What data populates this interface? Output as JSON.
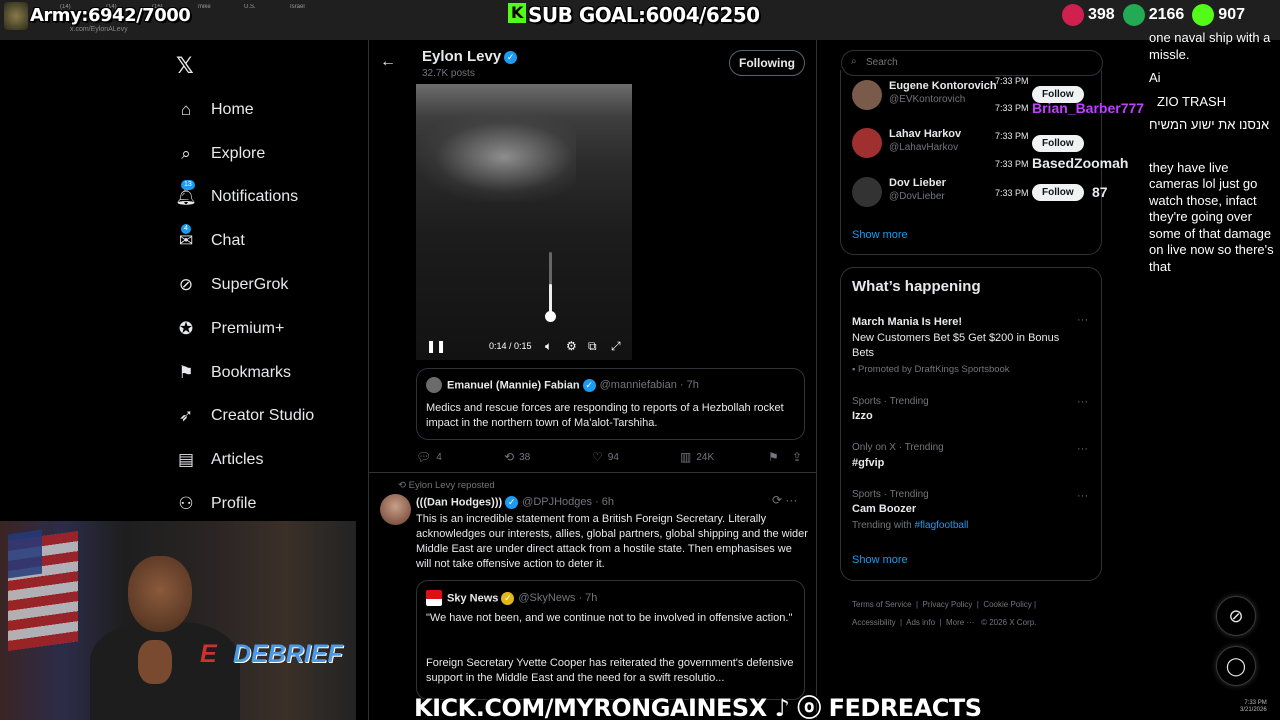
{
  "browser": {
    "tabs": [
      "(14)",
      "(14)",
      "(16)",
      "mike",
      "U.S.",
      "Israel",
      "Twitt",
      "Octo",
      "Design",
      "(17)",
      "18 U",
      "(17)"
    ],
    "url": "x.com/EylonALevy"
  },
  "overlays": {
    "army": "Army:6942/7000",
    "sub_goal": "SUB GOAL:6004/6250",
    "stats": [
      {
        "value": "398",
        "color": "#d02050",
        "icon": "gift-icon"
      },
      {
        "value": "2166",
        "color": "#22aa55",
        "icon": "kick-icon"
      },
      {
        "value": "907",
        "color": "#53fc18",
        "icon": "rumble-icon"
      }
    ],
    "bottom": "KICK.COM/MYRONGAINESX ♪ ⓞ FEDREACTS"
  },
  "nav": {
    "items": [
      {
        "label": "Home",
        "icon": "home-icon"
      },
      {
        "label": "Explore",
        "icon": "search-icon"
      },
      {
        "label": "Notifications",
        "icon": "bell-icon",
        "badge": "13"
      },
      {
        "label": "Chat",
        "icon": "mail-icon",
        "badge": "4"
      },
      {
        "label": "SuperGrok",
        "icon": "grok-icon"
      },
      {
        "label": "Premium+",
        "icon": "verified-icon"
      },
      {
        "label": "Bookmarks",
        "icon": "bookmark-icon"
      },
      {
        "label": "Creator Studio",
        "icon": "rocket-icon"
      },
      {
        "label": "Articles",
        "icon": "article-icon"
      },
      {
        "label": "Profile",
        "icon": "user-icon"
      }
    ]
  },
  "header": {
    "name": "Eylon Levy",
    "posts": "32.7K posts",
    "following": "Following"
  },
  "video": {
    "time": "0:14 / 0:15",
    "volume": 0.5
  },
  "quoted_post": {
    "name": "Emanuel (Mannie) Fabian",
    "handle": "@manniefabian · 7h",
    "text": "Medics and rescue forces are responding to reports of a Hezbollah rocket impact in the northern town of Ma'alot-Tarshiha."
  },
  "post_actions": {
    "replies": "4",
    "reposts": "38",
    "likes": "94",
    "views": "24K"
  },
  "post2": {
    "repost_line": "Eylon Levy reposted",
    "name": "(((Dan Hodges)))",
    "handle": "@DPJHodges · 6h",
    "text": "This is an incredible statement from a British Foreign Secretary. Literally acknowledges our interests, allies, global partners, global shipping and the wider Middle East are under direct attack from a hostile state. Then emphasises we will not take offensive action to deter it.",
    "quote": {
      "name": "Sky News",
      "handle": "@SkyNews · 7h",
      "text1": "\"We have not been, and we continue not to be involved in offensive action.\"",
      "text2": "Foreign Secretary Yvette Cooper has reiterated the government's defensive support in the Middle East and the need for a swift resolutio..."
    }
  },
  "sidebar": {
    "search_placeholder": "Search",
    "who_to_follow": [
      {
        "name": "Eugene Kontorovich",
        "handle": "@EVKontorovich"
      },
      {
        "name": "Lahav Harkov",
        "handle": "@LahavHarkov"
      },
      {
        "name": "Dov Lieber",
        "handle": "@DovLieber"
      }
    ],
    "follow_label": "Follow",
    "show_more": "Show more",
    "whats_happening": "What’s happening",
    "trends": [
      {
        "title": "March Mania Is Here!",
        "sub": "New Customers Bet $5 Get $200 in Bonus Bets",
        "promoted": "Promoted by DraftKings Sportsbook"
      },
      {
        "meta": "Sports · Trending",
        "title": "Izzo"
      },
      {
        "meta": "Only on X · Trending",
        "title": "#gfvip"
      },
      {
        "meta": "Sports · Trending",
        "title": "Cam Boozer",
        "trending_with": "Trending with",
        "link": "#flagfootball"
      }
    ],
    "footer": [
      "Terms of Service",
      "Privacy Policy",
      "Cookie Policy",
      "Accessibility",
      "Ads info",
      "More ···",
      "© 2026 X Corp."
    ]
  },
  "chat": {
    "lines": [
      "one naval ship with a missle.",
      "Ai",
      "ZIO TRASH",
      "אנסנו את ישוע המשיח",
      "they have live cameras lol just go watch those, infact they're going over some of that damage on live now so there's that"
    ],
    "overlay_names": [
      {
        "text": "Brian_Barber777",
        "color": "#c040ff"
      },
      {
        "text": "BasedZoomah",
        "color": "#ffffff"
      },
      {
        "text": "87",
        "color": "#ffffff"
      }
    ],
    "timestamps": [
      "7:33 PM",
      "7:33 PM",
      "7:33 PM",
      "7:33 PM",
      "7:33 PM"
    ]
  },
  "webcam": {
    "sign": "DEBRIEF",
    "sign_prefix": "E"
  },
  "clock": {
    "time": "7:33 PM",
    "date": "3/21/2026"
  }
}
